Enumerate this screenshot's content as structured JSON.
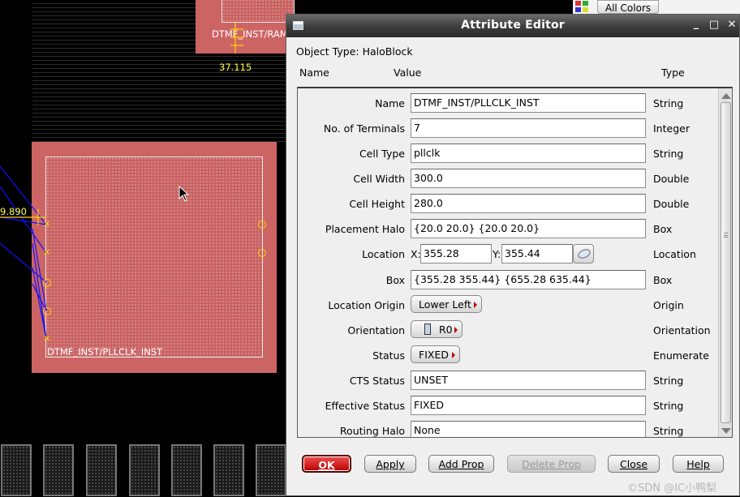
{
  "canvas": {
    "top_instance_label": "DTMF_INST/RAM",
    "dim_top": "37.115",
    "dim_left": "9.890",
    "main_instance_label": "DTMF_INST/PLLCLK_INST",
    "all_colors_label": "All Colors"
  },
  "dialog": {
    "title": "Attribute Editor",
    "object_type_label": "Object Type:",
    "object_type_value": "HaloBlock",
    "headers": {
      "name": "Name",
      "value": "Value",
      "type": "Type"
    },
    "rows": [
      {
        "label": "Name",
        "value": "DTMF_INST/PLLCLK_INST",
        "type": "String"
      },
      {
        "label": "No. of Terminals",
        "value": "7",
        "type": "Integer"
      },
      {
        "label": "Cell Type",
        "value": "pllclk",
        "type": "String"
      },
      {
        "label": "Cell Width",
        "value": "300.0",
        "type": "Double"
      },
      {
        "label": "Cell Height",
        "value": "280.0",
        "type": "Double"
      },
      {
        "label": "Placement Halo",
        "value": "{20.0 20.0} {20.0 20.0}",
        "type": "Box"
      },
      {
        "label": "Location",
        "x_label": "X:",
        "x_value": "355.28",
        "y_label": "Y:",
        "y_value": "355.44",
        "type": "Location"
      },
      {
        "label": "Box",
        "value": "{355.28 355.44} {655.28 635.44}",
        "type": "Box"
      },
      {
        "label": "Location Origin",
        "value": "Lower Left",
        "type": "Origin"
      },
      {
        "label": "Orientation",
        "value": "R0",
        "type": "Orientation"
      },
      {
        "label": "Status",
        "value": "FIXED",
        "type": "Enumerate"
      },
      {
        "label": "CTS Status",
        "value": "UNSET",
        "type": "String"
      },
      {
        "label": "Effective Status",
        "value": "FIXED",
        "type": "String"
      },
      {
        "label": "Routing Halo",
        "value": "None",
        "type": "String"
      }
    ],
    "buttons": {
      "ok": "OK",
      "apply": "Apply",
      "add_prop": "Add Prop",
      "delete_prop": "Delete Prop",
      "close": "Close",
      "help": "Help"
    },
    "watermark": "©SDN @IC小鸭梨"
  },
  "colors": {
    "halo_fill": "#cd6464",
    "ok_button": "#d01010",
    "titlebar": "#3c3c3c",
    "dimension_text": "#ffff40",
    "net_lines": "#0000ff"
  },
  "icons": [
    "app-icon",
    "minimize-icon",
    "maximize-icon",
    "close-icon",
    "pick-location-icon",
    "orientation-icon",
    "mouse-cursor-icon",
    "color-palette-icon"
  ]
}
